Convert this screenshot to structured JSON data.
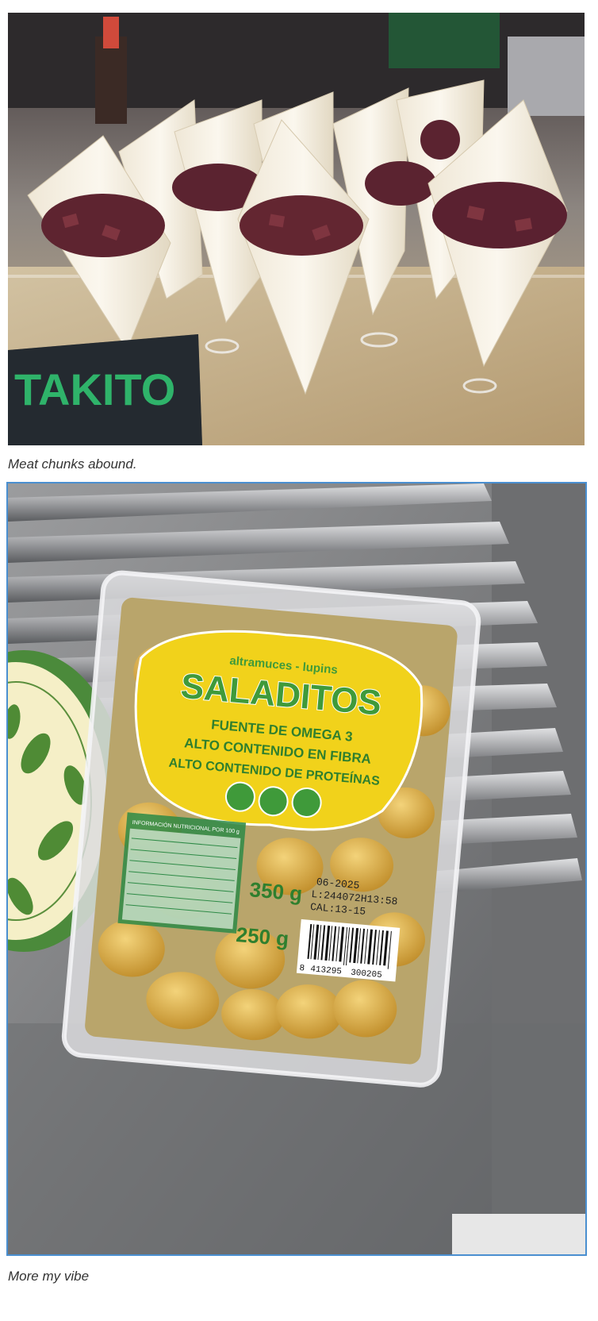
{
  "figures": [
    {
      "caption": "Meat chunks abound.",
      "sign_text": "TAKITO"
    },
    {
      "caption": "More my vibe",
      "label": {
        "subtitle": "altramuces - lupins",
        "brand": "SALADITOS",
        "claims": [
          "FUENTE DE OMEGA 3",
          "ALTO CONTENIDO EN FIBRA",
          "ALTO CONTENIDO DE PROTEÍNAS"
        ],
        "nutrition_title": "INFORMACIÓN NUTRICIONAL POR 100 g",
        "weight_net": "350 g",
        "weight_drained": "250 g",
        "date_code": [
          "06-2025",
          "L:244072H13:58",
          "CAL:13-15"
        ],
        "barcode": [
          "8",
          "413295",
          "300205"
        ]
      }
    }
  ],
  "colors": {
    "border_accent": "#4a8fd0",
    "label_yellow": "#f1d21b",
    "label_green": "#3f9a3a",
    "sign_green": "#2fb36a"
  }
}
